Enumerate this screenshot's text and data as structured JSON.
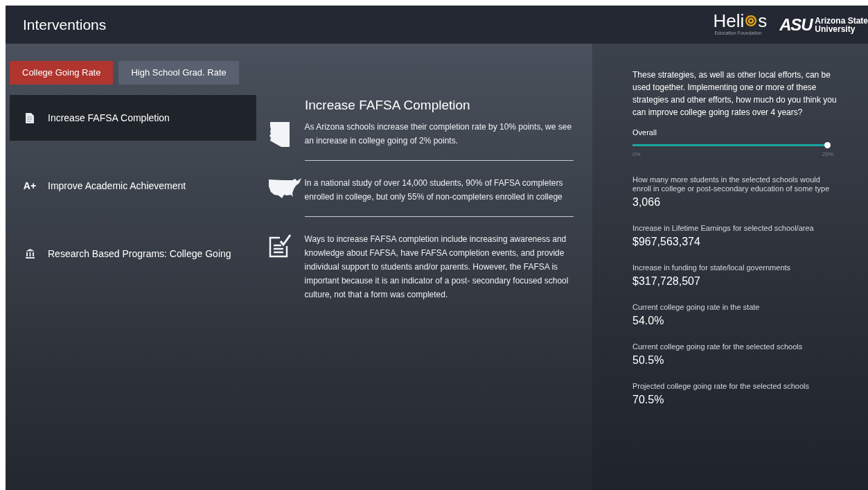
{
  "header": {
    "title": "Interventions",
    "logos": [
      {
        "kind": "helios",
        "name": "Heli",
        "name_end": "s",
        "tagline": "Education Foundation"
      },
      {
        "kind": "asu",
        "mark": "ASU",
        "name": "Arizona State",
        "tagline": "University"
      }
    ]
  },
  "tabs": [
    {
      "label": "College Going Rate",
      "selected": true
    },
    {
      "label": "High School Grad. Rate",
      "selected": false
    }
  ],
  "interventions": [
    {
      "label": "Increase FAFSA Completion",
      "kind": "document",
      "selected": true
    },
    {
      "label": "Improve Academic Achievement",
      "kind": "grade",
      "icon_text": "A+",
      "selected": false
    },
    {
      "label": "Research Based Programs: College Going",
      "kind": "building",
      "selected": false
    }
  ],
  "detail": {
    "title": "Increase FAFSA Completion",
    "facts": [
      {
        "kind": "state",
        "text": "As Arizona schools increase their completion rate by 10% points, we see an increase in college going of 2% points."
      },
      {
        "kind": "country",
        "text": "In a national study of over 14,000 students, 90% of FAFSA completers enrolled in college, but only 55% of non-completers enrolled in college"
      },
      {
        "kind": "checklist",
        "text": "Ways to increase FAFSA completion include increasing awareness and knowledge about FAFSA, have FAFSA completion events, and provide individual support to students and/or parents. However, the FAFSA is important because it is an indicator of a post- secondary focused school culture, not that a form was completed."
      }
    ]
  },
  "results": {
    "intro": "These strategies, as well as other local efforts, can be used together. Implementing one or more of these strategies and other efforts, how much do you think you can improve college going rates over 4 years?",
    "slider": {
      "label": "Overall",
      "level": 1.0,
      "min_label": "0%",
      "max_label": "20%"
    },
    "metrics": [
      {
        "label": "How many more students in the selected schools would enroll in college or post-secondary education of some type",
        "value": "3,066"
      },
      {
        "label": "Increase in Lifetime Earnings for selected school/area",
        "value": "$967,563,374"
      },
      {
        "label": "Increase in funding for state/local governments",
        "value": "$317,728,507"
      },
      {
        "label": "Current college going rate in the state",
        "value": "54.0%"
      },
      {
        "label": "Current college going rate for the selected schools",
        "value": "50.5%"
      },
      {
        "label": "Projected college going rate for the selected schools",
        "value": "70.5%"
      }
    ]
  }
}
